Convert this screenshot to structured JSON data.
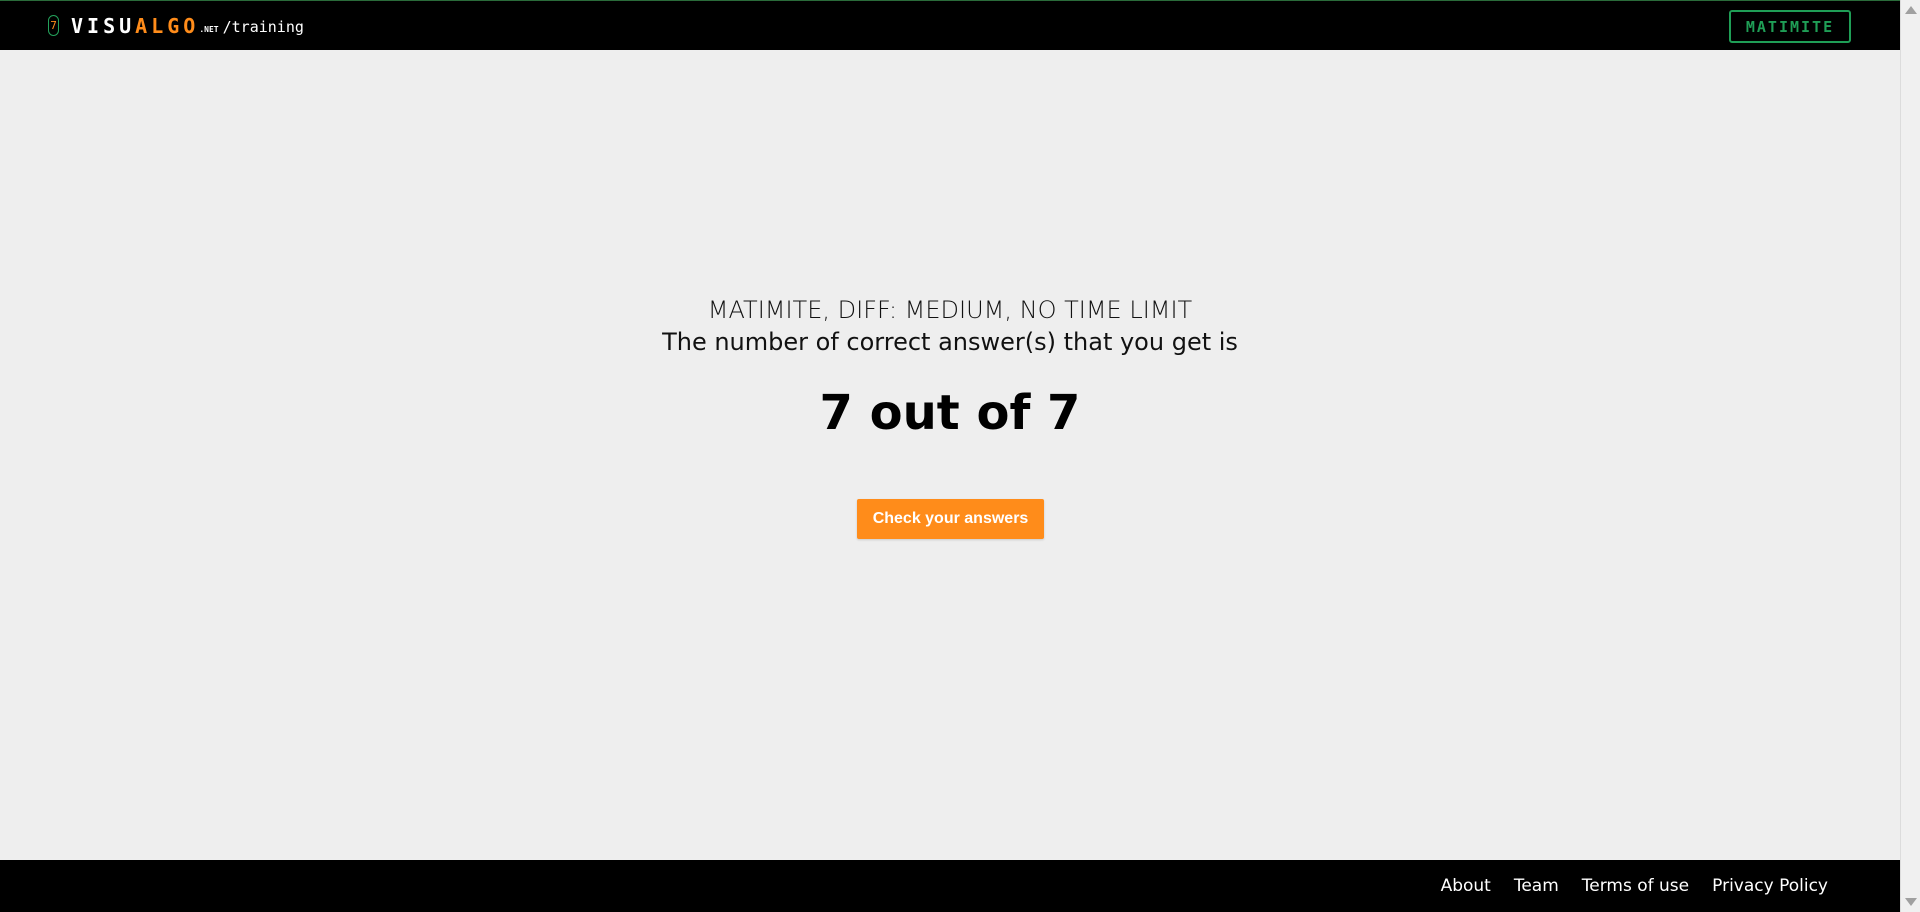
{
  "header": {
    "logo_badge": "7",
    "logo_visu": "VISU",
    "logo_algo": "ALGO",
    "logo_net": ".NET",
    "logo_path": "/training",
    "user_button": "MATIMITE"
  },
  "result": {
    "quiz_meta": "MATIMITE, DIFF: MEDIUM, NO TIME LIMIT",
    "description": "The number of correct answer(s) that you get is",
    "score": "7 out of 7",
    "correct": 7,
    "total": 7,
    "check_button": "Check your answers"
  },
  "footer": {
    "links": [
      "About",
      "Team",
      "Terms of use",
      "Privacy Policy"
    ]
  },
  "colors": {
    "accent_orange": "#ff8c1a",
    "accent_green": "#1f9e56",
    "background": "#eeeeee",
    "bar": "#000000"
  },
  "icons": {
    "scroll_up": "scroll-up-arrow-icon",
    "scroll_down": "scroll-down-arrow-icon"
  }
}
